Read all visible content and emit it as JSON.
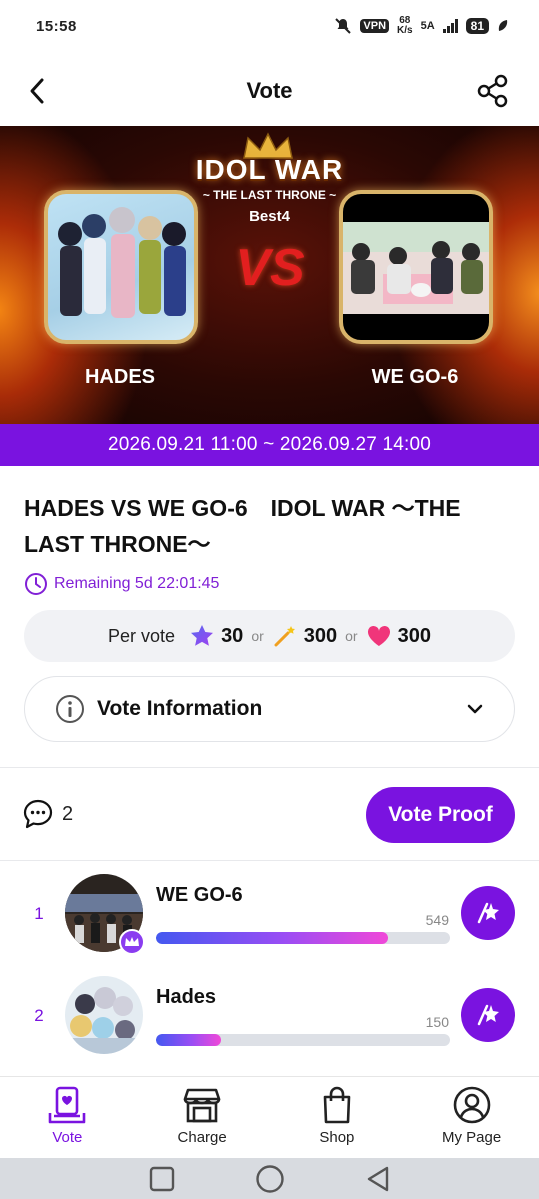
{
  "status_bar": {
    "time": "15:58",
    "vpn": "VPN",
    "speed_value": "68",
    "speed_unit": "K/s",
    "network": "5A",
    "battery": "81"
  },
  "header": {
    "title": "Vote",
    "back_icon": "chevron-left-icon",
    "share_icon": "share-icon"
  },
  "banner": {
    "title": "IDOL WAR",
    "subtitle": "~ THE LAST THRONE ~",
    "round": "Best4",
    "vs": "VS",
    "team_left": "HADES",
    "team_right": "WE GO-6"
  },
  "date_range": "2026.09.21 11:00 ~ 2026.09.27 14:00",
  "event": {
    "title": "HADES VS WE GO-6　IDOL WAR ～THE LAST THRONE～",
    "remaining": "Remaining 5d 22:01:45"
  },
  "per_vote": {
    "label": "Per vote",
    "star_cost": "30",
    "or1": "or",
    "wand_cost": "300",
    "or2": "or",
    "heart_cost": "300"
  },
  "vote_information": {
    "label": "Vote Information"
  },
  "comments": {
    "count": "2"
  },
  "vote_proof_label": "Vote Proof",
  "ranking": [
    {
      "rank": "1",
      "name": "WE GO-6",
      "votes": "549",
      "progress": 0.79,
      "crown": true
    },
    {
      "rank": "2",
      "name": "Hades",
      "votes": "150",
      "progress": 0.22,
      "crown": false
    }
  ],
  "bottom_nav": [
    {
      "label": "Vote",
      "icon": "vote-icon",
      "active": true
    },
    {
      "label": "Charge",
      "icon": "store-icon",
      "active": false
    },
    {
      "label": "Shop",
      "icon": "shopping-bag-icon",
      "active": false
    },
    {
      "label": "My Page",
      "icon": "user-icon",
      "active": false
    }
  ],
  "colors": {
    "accent": "#7a13e0",
    "remaining_text": "#8120d6",
    "bar_gradient_start": "#4458f0",
    "bar_gradient_end": "#f048d8"
  }
}
